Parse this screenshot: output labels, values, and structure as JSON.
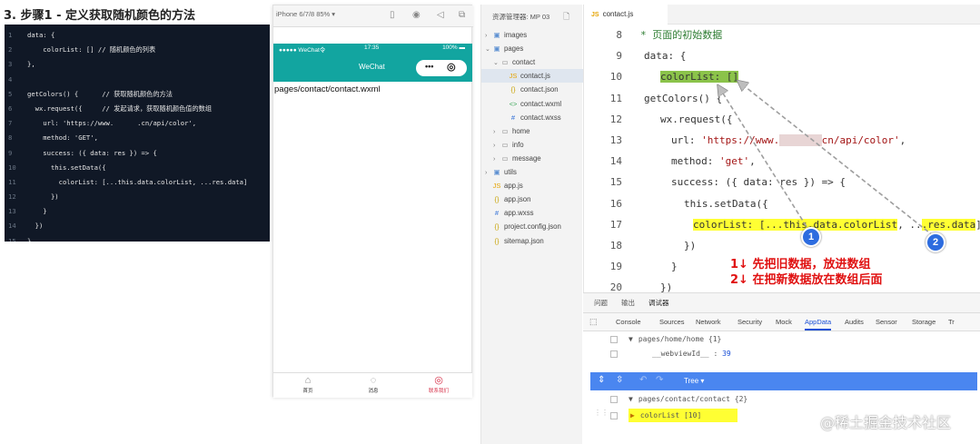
{
  "heading": "3. 步骤1 - 定义获取随机颜色的方法",
  "code_panel": {
    "lines": [
      {
        "n": "1",
        "t": "data: {"
      },
      {
        "n": "2",
        "t": "    colorList: [] // 随机颜色的列表"
      },
      {
        "n": "3",
        "t": "},"
      },
      {
        "n": "4",
        "t": ""
      },
      {
        "n": "5",
        "t": "getColors() {      // 获取随机颜色的方法"
      },
      {
        "n": "6",
        "t": "  wx.request({     // 发起请求，获取随机颜色值的数组"
      },
      {
        "n": "7",
        "t": "    url: 'https://www.      .cn/api/color',"
      },
      {
        "n": "8",
        "t": "    method: 'GET',"
      },
      {
        "n": "9",
        "t": "    success: ({ data: res }) => {"
      },
      {
        "n": "10",
        "t": "      this.setData({"
      },
      {
        "n": "11",
        "t": "        colorList: [...this.data.colorList, ...res.data]"
      },
      {
        "n": "12",
        "t": "      })"
      },
      {
        "n": "13",
        "t": "    }"
      },
      {
        "n": "14",
        "t": "  })"
      },
      {
        "n": "15",
        "t": "}"
      }
    ]
  },
  "simulator": {
    "device": "iPhone 6/7/8 85% ▾",
    "status_left": "●●●●● WeChat令",
    "status_time": "17:35",
    "status_right": "100% ▬",
    "nav_title": "WeChat",
    "capsule_dots": "•••",
    "capsule_circle": "◎",
    "page_path": "pages/contact/contact.wxml",
    "tabs": [
      {
        "icon": "⌂",
        "label": "首页"
      },
      {
        "icon": "◌",
        "label": "消息"
      },
      {
        "icon": "◎",
        "label": "联系我们"
      }
    ]
  },
  "explorer": {
    "title": "资源管理器: MP 03",
    "items": [
      {
        "arrow": "›",
        "icon": "▣",
        "label": "images",
        "indent": 1
      },
      {
        "arrow": "⌄",
        "icon": "▣",
        "label": "pages",
        "indent": 1
      },
      {
        "arrow": "⌄",
        "icon": "▭",
        "label": "contact",
        "indent": 2
      },
      {
        "arrow": "",
        "icon": "JS",
        "label": "contact.js",
        "indent": 3,
        "selected": true
      },
      {
        "arrow": "",
        "icon": "{}",
        "label": "contact.json",
        "indent": 3
      },
      {
        "arrow": "",
        "icon": "<>",
        "label": "contact.wxml",
        "indent": 3
      },
      {
        "arrow": "",
        "icon": "#",
        "label": "contact.wxss",
        "indent": 3
      },
      {
        "arrow": "›",
        "icon": "▭",
        "label": "home",
        "indent": 2
      },
      {
        "arrow": "›",
        "icon": "▭",
        "label": "info",
        "indent": 2
      },
      {
        "arrow": "›",
        "icon": "▭",
        "label": "message",
        "indent": 2
      },
      {
        "arrow": "›",
        "icon": "▣",
        "label": "utils",
        "indent": 1
      },
      {
        "arrow": "",
        "icon": "JS",
        "label": "app.js",
        "indent": 1
      },
      {
        "arrow": "",
        "icon": "{}",
        "label": "app.json",
        "indent": 1
      },
      {
        "arrow": "",
        "icon": "#",
        "label": "app.wxss",
        "indent": 1
      },
      {
        "arrow": "",
        "icon": "{}",
        "label": "project.config.json",
        "indent": 1
      },
      {
        "arrow": "",
        "icon": "{}",
        "label": "sitemap.json",
        "indent": 1
      }
    ]
  },
  "editor": {
    "tab": "contact.js",
    "lines": [
      {
        "n": "8",
        "t": "* 页面的初始数据"
      },
      {
        "n": "9",
        "t": "data: {"
      },
      {
        "n": "10",
        "t": "colorList: []"
      },
      {
        "n": "11",
        "t": "getColors() {"
      },
      {
        "n": "12",
        "t": "wx.request({"
      },
      {
        "n": "13",
        "a": "url: ",
        "b": "'https://www.",
        "c": "cn/api/color'",
        "d": ","
      },
      {
        "n": "14",
        "a": "method: ",
        "b": "'get'",
        "d": ","
      },
      {
        "n": "15",
        "t": "success: ({ data: res }) => {"
      },
      {
        "n": "16",
        "t": "this.setData({"
      },
      {
        "n": "17",
        "a": "colorList: [",
        "b": "...this.data.colorList",
        "c": ", ..",
        "d": ".res.data",
        "e": "]"
      },
      {
        "n": "18",
        "t": "})"
      },
      {
        "n": "19",
        "t": "}"
      },
      {
        "n": "20",
        "t": "})"
      }
    ],
    "badge1": "1",
    "badge2": "2",
    "note1": "1↓ 先把旧数据，放进数组",
    "note2": "2↓ 在把新数据放在数组后面"
  },
  "devtools": {
    "top_tabs": [
      "问题",
      "输出",
      "调试器"
    ],
    "panels": [
      "Console",
      "Sources",
      "Network",
      "Security",
      "Mock",
      "AppData",
      "Audits",
      "Sensor",
      "Storage",
      "Tr"
    ],
    "active_panel": "AppData",
    "tree1_path": "pages/home/home {1}",
    "tree1_key": "__webviewId__",
    "tree1_val": "39",
    "toolbar_label": "Tree ▾",
    "tree2_path": "pages/contact/contact {2}",
    "tree2_item": "colorList [10]"
  },
  "watermark": "@稀土掘金技术社区"
}
